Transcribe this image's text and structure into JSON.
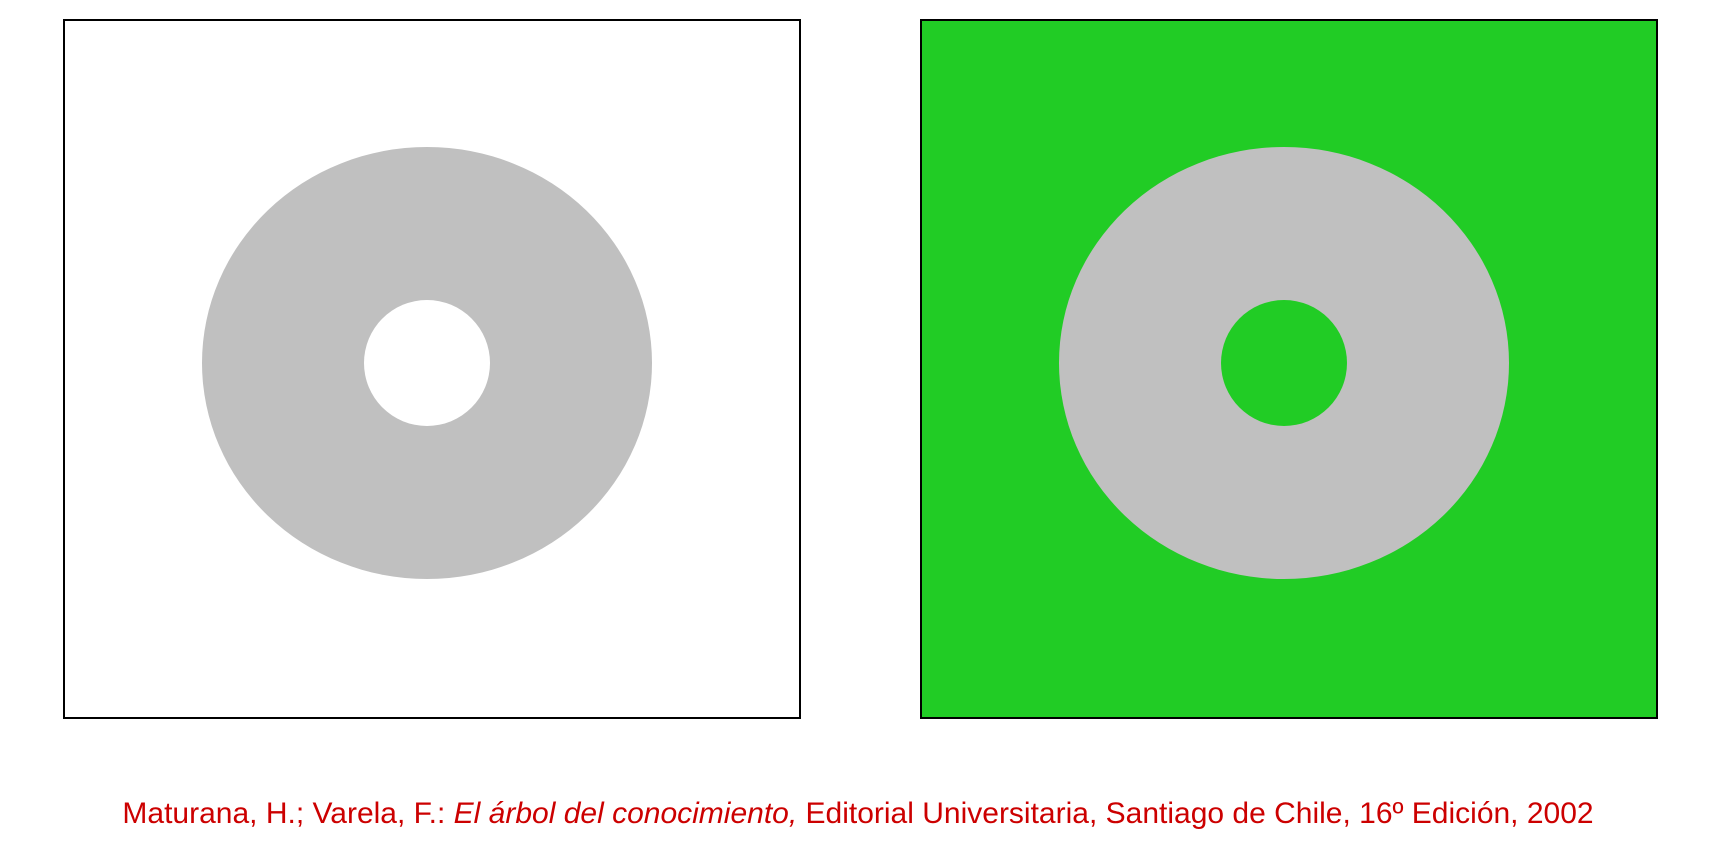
{
  "figure": {
    "colors": {
      "ring": "#c0c0c0",
      "left_background": "#ffffff",
      "right_background": "#21cc25",
      "border": "#000000",
      "citation_text": "#cc0000"
    },
    "panels": [
      {
        "name": "white-panel",
        "background_color": "#ffffff"
      },
      {
        "name": "green-panel",
        "background_color": "#21cc25"
      }
    ]
  },
  "citation": {
    "authors": "Maturana, H.; Varela, F.: ",
    "title": "El árbol del conocimiento,",
    "publisher": " Editorial Universitaria, Santiago de Chile, 16º Edición, 2002"
  }
}
